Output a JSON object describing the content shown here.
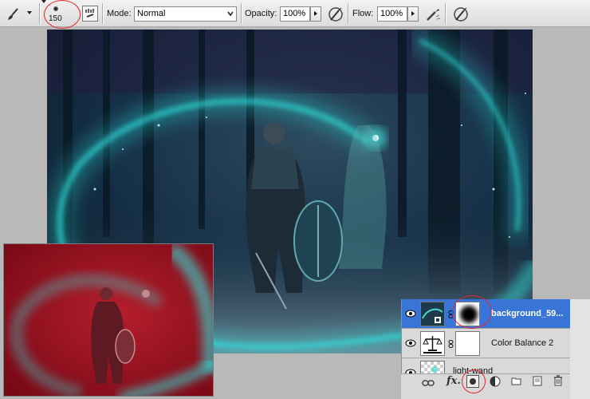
{
  "options_bar": {
    "brush_size": "150",
    "mode_label": "Mode:",
    "mode_value": "Normal",
    "opacity_label": "Opacity:",
    "opacity_value": "100%",
    "flow_label": "Flow:",
    "flow_value": "100%"
  },
  "layers": [
    {
      "name": "background_59...",
      "active": true
    },
    {
      "name": "Color Balance 2",
      "active": false
    },
    {
      "name": "light-wand",
      "active": false
    }
  ],
  "layers_footer": {
    "fx": "fx."
  },
  "colors": {
    "highlight": "#3875d7",
    "annotation": "#e8262a",
    "mask_red": "#8a0d19",
    "glow": "#2ee6e0"
  }
}
